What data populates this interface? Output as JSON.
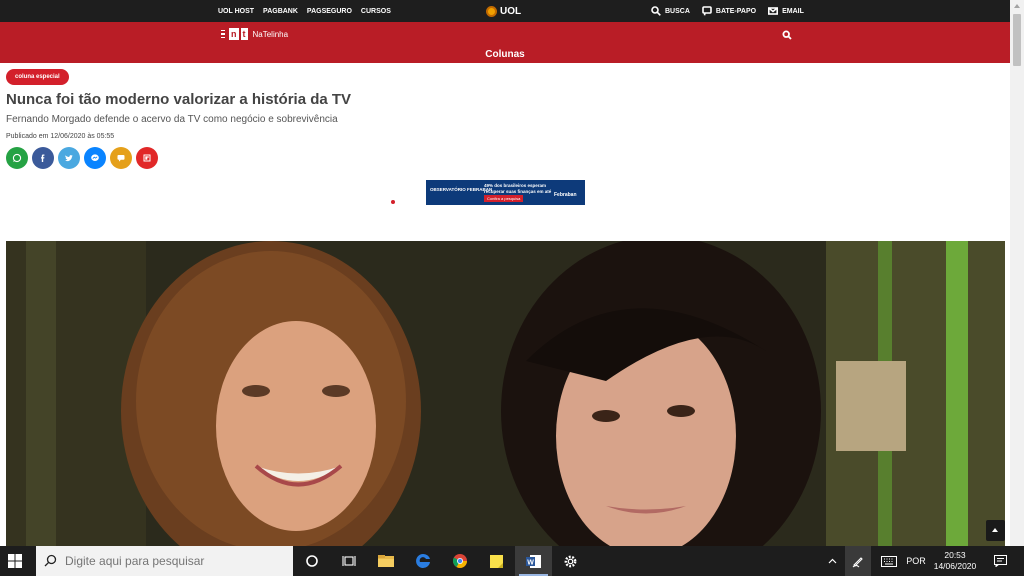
{
  "topbar": {
    "links": [
      "UOL HOST",
      "PAGBANK",
      "PAGSEGURO",
      "CURSOS"
    ],
    "logo": "UOL",
    "search_label": "BUSCA",
    "chat_label": "BATE-PAPO",
    "email_label": "EMAIL"
  },
  "site": {
    "brand_n": "n",
    "brand_t": "t",
    "brand_name": "NaTelinha",
    "section": "Colunas"
  },
  "article": {
    "tag": "coluna especial",
    "headline": "Nunca foi tão moderno valorizar a história da TV",
    "subhead": "Fernando Morgado defende o acervo da TV como negócio e sobrevivência",
    "published": "Publicado em 12/06/2020 às 05:55"
  },
  "ad": {
    "brand": "OBSERVATÓRIO FEBRABAN",
    "text": "49% dos brasileiros esperam recuperar suas finanças em até 1 ano.",
    "cta": "Confira a pesquisa",
    "logo": "Febraban"
  },
  "share": [
    {
      "name": "whatsapp",
      "color": "#25a244"
    },
    {
      "name": "facebook",
      "color": "#3b5a9a"
    },
    {
      "name": "twitter",
      "color": "#4aa8e0"
    },
    {
      "name": "messenger",
      "color": "#0a84ff"
    },
    {
      "name": "comment",
      "color": "#e5a01a"
    },
    {
      "name": "flipboard",
      "color": "#e12828"
    }
  ],
  "taskbar": {
    "search_placeholder": "Digite aqui para pesquisar",
    "language": "POR",
    "time": "20:53",
    "date": "14/06/2020"
  },
  "colors": {
    "header_red": "#b91d26",
    "topbar": "#1e1e1e",
    "taskbar": "#1d1d1d"
  }
}
